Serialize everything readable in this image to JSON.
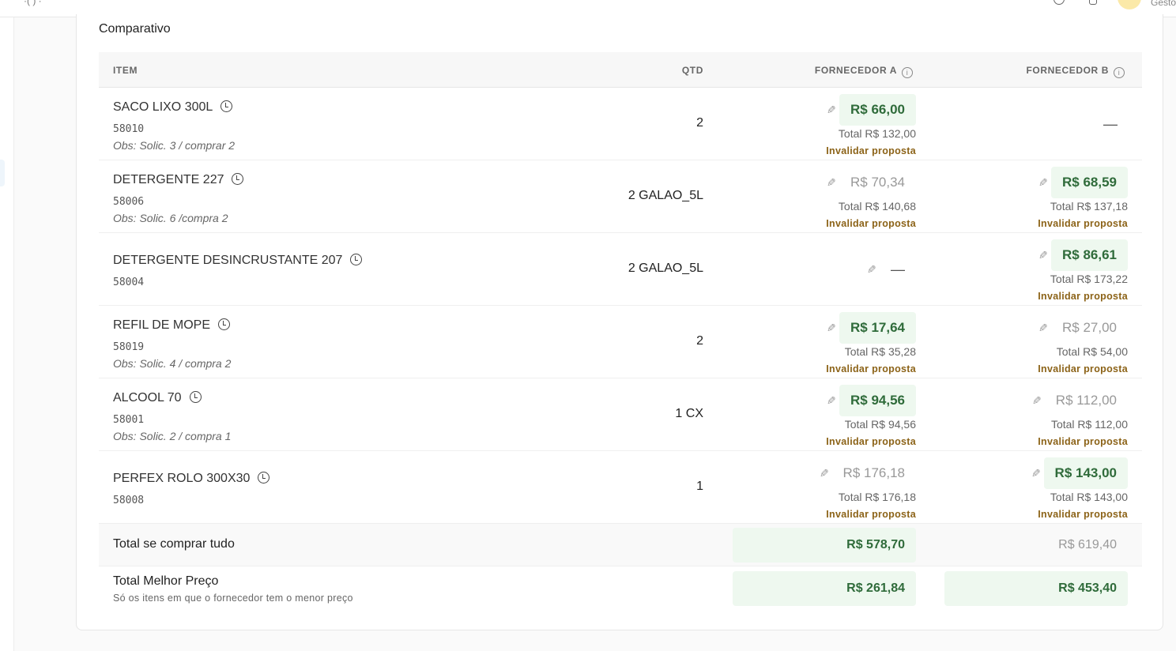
{
  "topbar": {
    "user_fragment": "Gesto"
  },
  "card": {
    "title": "Comparativo"
  },
  "table": {
    "headers": {
      "item": "ITEM",
      "qtd": "QTD",
      "supplier_a": "FORNECEDOR A",
      "supplier_b": "FORNECEDOR B"
    },
    "invalidate_label": "Invalidar proposta",
    "rows": [
      {
        "name": "SACO LIXO 300L",
        "code": "58010",
        "obs": "Obs: Solic. 3 / comprar 2",
        "qtd": "2",
        "a": {
          "price": "R$ 66,00",
          "total": "Total R$ 132,00",
          "best": true
        },
        "b": {
          "empty": "—"
        }
      },
      {
        "name": "DETERGENTE 227",
        "code": "58006",
        "obs": "Obs: Solic. 6 /compra 2",
        "qtd": "2 GALAO_5L",
        "a": {
          "price": "R$ 70,34",
          "total": "Total R$ 140,68",
          "best": false
        },
        "b": {
          "price": "R$ 68,59",
          "total": "Total R$ 137,18",
          "best": true
        }
      },
      {
        "name": "DETERGENTE DESINCRUSTANTE 207",
        "code": "58004",
        "obs": "",
        "qtd": "2 GALAO_5L",
        "a": {
          "empty": "—"
        },
        "b": {
          "price": "R$ 86,61",
          "total": "Total R$ 173,22",
          "best": true
        }
      },
      {
        "name": "REFIL DE MOPE",
        "code": "58019",
        "obs": "Obs: Solic. 4 / compra 2",
        "qtd": "2",
        "a": {
          "price": "R$ 17,64",
          "total": "Total R$ 35,28",
          "best": true
        },
        "b": {
          "price": "R$ 27,00",
          "total": "Total R$ 54,00",
          "best": false
        }
      },
      {
        "name": "ALCOOL 70",
        "code": "58001",
        "obs": "Obs: Solic. 2 / compra 1",
        "qtd": "1 CX",
        "a": {
          "price": "R$ 94,56",
          "total": "Total R$ 94,56",
          "best": true
        },
        "b": {
          "price": "R$ 112,00",
          "total": "Total R$ 112,00",
          "best": false
        }
      },
      {
        "name": "PERFEX ROLO 300X30",
        "code": "58008",
        "obs": "",
        "qtd": "1",
        "a": {
          "price": "R$ 176,18",
          "total": "Total R$ 176,18",
          "best": false
        },
        "b": {
          "price": "R$ 143,00",
          "total": "Total R$ 143,00",
          "best": true
        }
      }
    ],
    "summary": {
      "total_all_label": "Total se comprar tudo",
      "total_all_a": "R$ 578,70",
      "total_all_b": "R$ 619,40",
      "best_price_label": "Total Melhor Preço",
      "best_price_sub": "Só os itens em que o fornecedor tem o menor preço",
      "best_price_a": "R$ 261,84",
      "best_price_b": "R$ 453,40"
    }
  }
}
